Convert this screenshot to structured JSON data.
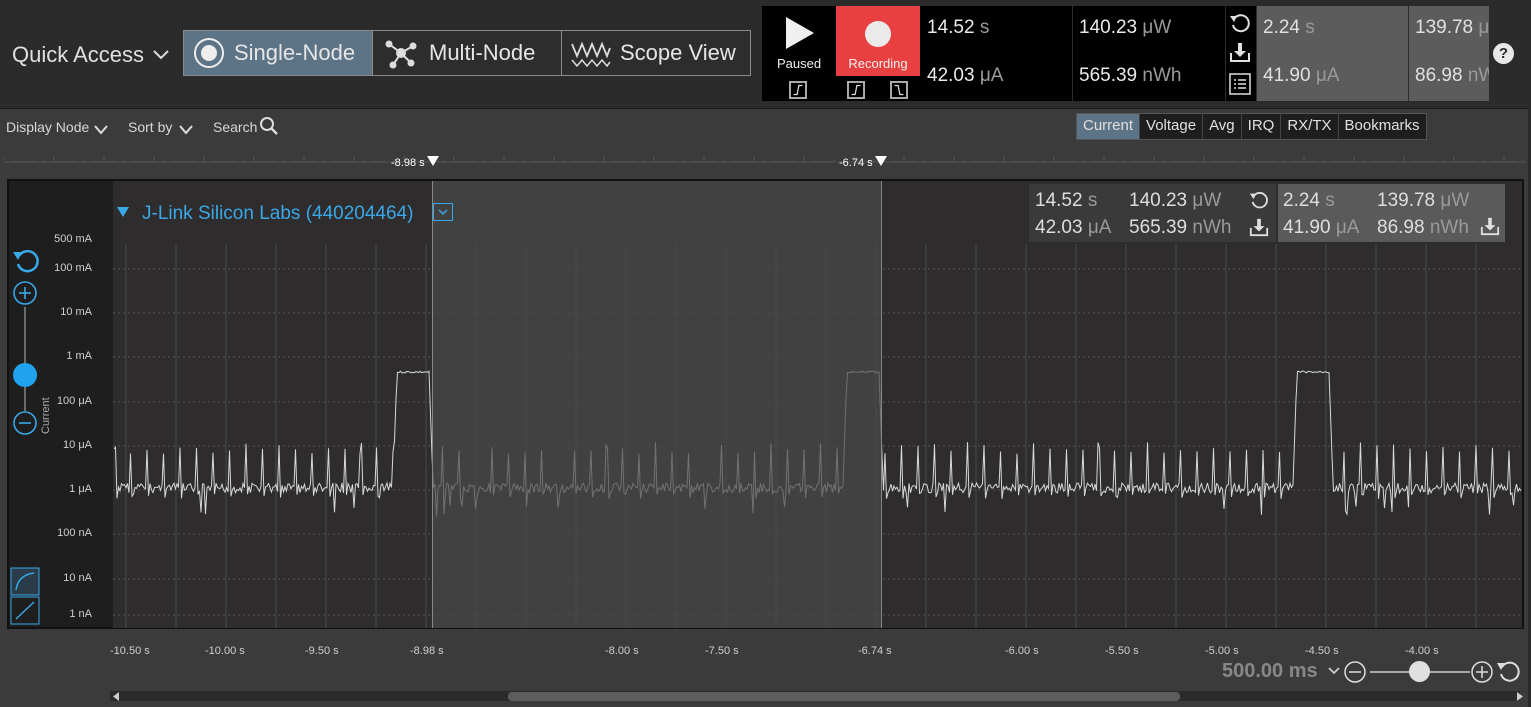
{
  "quick_access": {
    "label": "Quick Access"
  },
  "modes": [
    {
      "label": "Single-Node",
      "active": true,
      "icon": "single-node-icon"
    },
    {
      "label": "Multi-Node",
      "active": false,
      "icon": "multi-node-icon"
    },
    {
      "label": "Scope View",
      "active": false,
      "icon": "scope-wave-icon"
    }
  ],
  "controls": {
    "paused": "Paused",
    "recording": "Recording"
  },
  "stats_main": {
    "time_val": "14.52",
    "time_unit": "s",
    "current_val": "42.03",
    "current_unit": "μA",
    "power_val": "140.23",
    "power_unit": "μW",
    "energy_val": "565.39",
    "energy_unit": "nWh"
  },
  "stats_sel": {
    "time_val": "2.24",
    "time_unit": "s",
    "current_val": "41.90",
    "current_unit": "μA",
    "power_val": "139.78",
    "power_unit": "μW",
    "energy_val": "86.98",
    "energy_unit": "nWh"
  },
  "help": "?",
  "toolbar": {
    "display_node": "Display Node",
    "sort_by": "Sort by",
    "search": "Search"
  },
  "tabs": [
    "Current",
    "Voltage",
    "Avg",
    "IRQ",
    "RX/TX",
    "Bookmarks"
  ],
  "active_tab": "Current",
  "markers": [
    "-8.98 s",
    "-6.74 s"
  ],
  "node": {
    "name": "J-Link Silicon Labs (440204464)"
  },
  "y_axis": {
    "title": "Current",
    "labels": [
      "500 mA",
      "100 mA",
      "10 mA",
      "1 mA",
      "100 μA",
      "10 μA",
      "1 μA",
      "100 nA",
      "10 nA",
      "1 nA"
    ]
  },
  "x_axis": {
    "labels": [
      "-10.50 s",
      "-10.00 s",
      "-9.50 s",
      "-8.98 s",
      "-8.00 s",
      "-7.50 s",
      "-6.74 s",
      "-6.00 s",
      "-5.50 s",
      "-5.00 s",
      "-4.50 s",
      "-4.00 s"
    ]
  },
  "zoom": {
    "label": "500.00 ms"
  },
  "colors": {
    "accent": "#39a8e8",
    "recording": "#e84040",
    "active_tab": "#5d7386",
    "trace": "#d8d8d8"
  }
}
